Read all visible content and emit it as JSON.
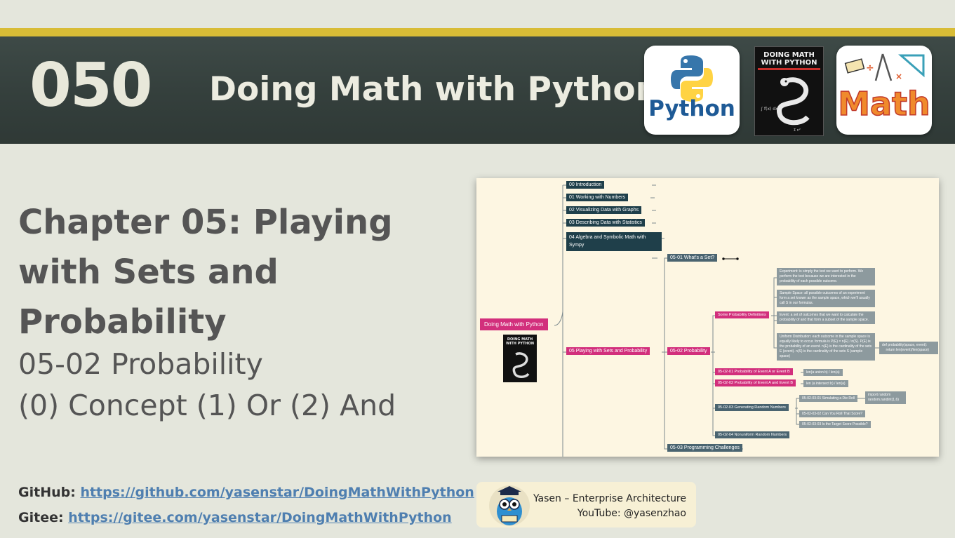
{
  "header": {
    "episode": "050",
    "title": "Doing Math with Python",
    "python_logo_text": "Python",
    "math_logo_text": "Math",
    "book": {
      "title": "DOING MATH WITH PYTHON"
    }
  },
  "chapter": {
    "title": "Chapter 05: Playing with Sets and Probability"
  },
  "lesson": {
    "line1": "05-02 Probability",
    "line2": "(0) Concept (1) Or (2) And"
  },
  "links": {
    "github_label": "GitHub:",
    "github_url": "https://github.com/yasenstar/DoingMathWithPython",
    "gitee_label": "Gitee:",
    "gitee_url": "https://gitee.com/yasenstar/DoingMathWithPython"
  },
  "mindmap": {
    "root": "Doing Math with Python",
    "root_book": "DOING MATH WITH PYTHON",
    "chapters": [
      "00 Introduction",
      "01 Working with Numbers",
      "02 Visualizing Data with Graphs",
      "03 Describing Data with Statistics",
      "04 Algebra and Symbolic Math with Sympy",
      "05 Playing with Sets and Probability"
    ],
    "sections": [
      "05-01 What's a Set?",
      "05-02 Probability",
      "05-03 Programming Challenges"
    ],
    "subsections": [
      "Some Probability Definitions",
      "05-02-01 Probability of Event A or Event B",
      "05-02-02 Probability of Event A and Event B",
      "05-02-03 Generating Random Numbers",
      "05-02-04 Nonuniform Random Numbers"
    ],
    "definitions": [
      "Experiment: is simply the test we want to perform. We perform the test because we are interested in the probability of each possible outcome.",
      "Sample Space: all possible outcomes of an experiment form a set known as the sample space, which we'll usually call S in our formulas.",
      "Event: a set of outcomes that we want to calculate the probability of and that form a subset of the sample space.",
      "Uniform Distribution: each outcome in the sample space is equally likely to occur. formula is P(E) = n(E) / n(S). P(E) is the probability of an event. n(E) is the cardinality of the sets E (event). n(S) is the cardinality of the sets S (sample space)"
    ],
    "code_probability": "def probability(space, event):\n    return len(event)/len(space)",
    "or_formula": "len(a union b) / len(a)",
    "and_formula": "len (a intersect b) / len(a)",
    "random_items": [
      "05-02-03-01 Simulating a Die Roll",
      "05-02-03-02 Can You Roll That Score?",
      "05-02-03-03 Is the Target Score Possible?"
    ],
    "random_code": "import random\nrandom.randint(1,6)"
  },
  "author": {
    "name": "Yasen – Enterprise Architecture",
    "youtube": "YouTube: @yasenzhao"
  },
  "colors": {
    "banner": "#35403d",
    "gold": "#d8bc36",
    "background": "#e4e6dc",
    "link": "#4f7fb0",
    "mm_dark": "#1f3f4a",
    "mm_pink": "#d22f7c"
  }
}
